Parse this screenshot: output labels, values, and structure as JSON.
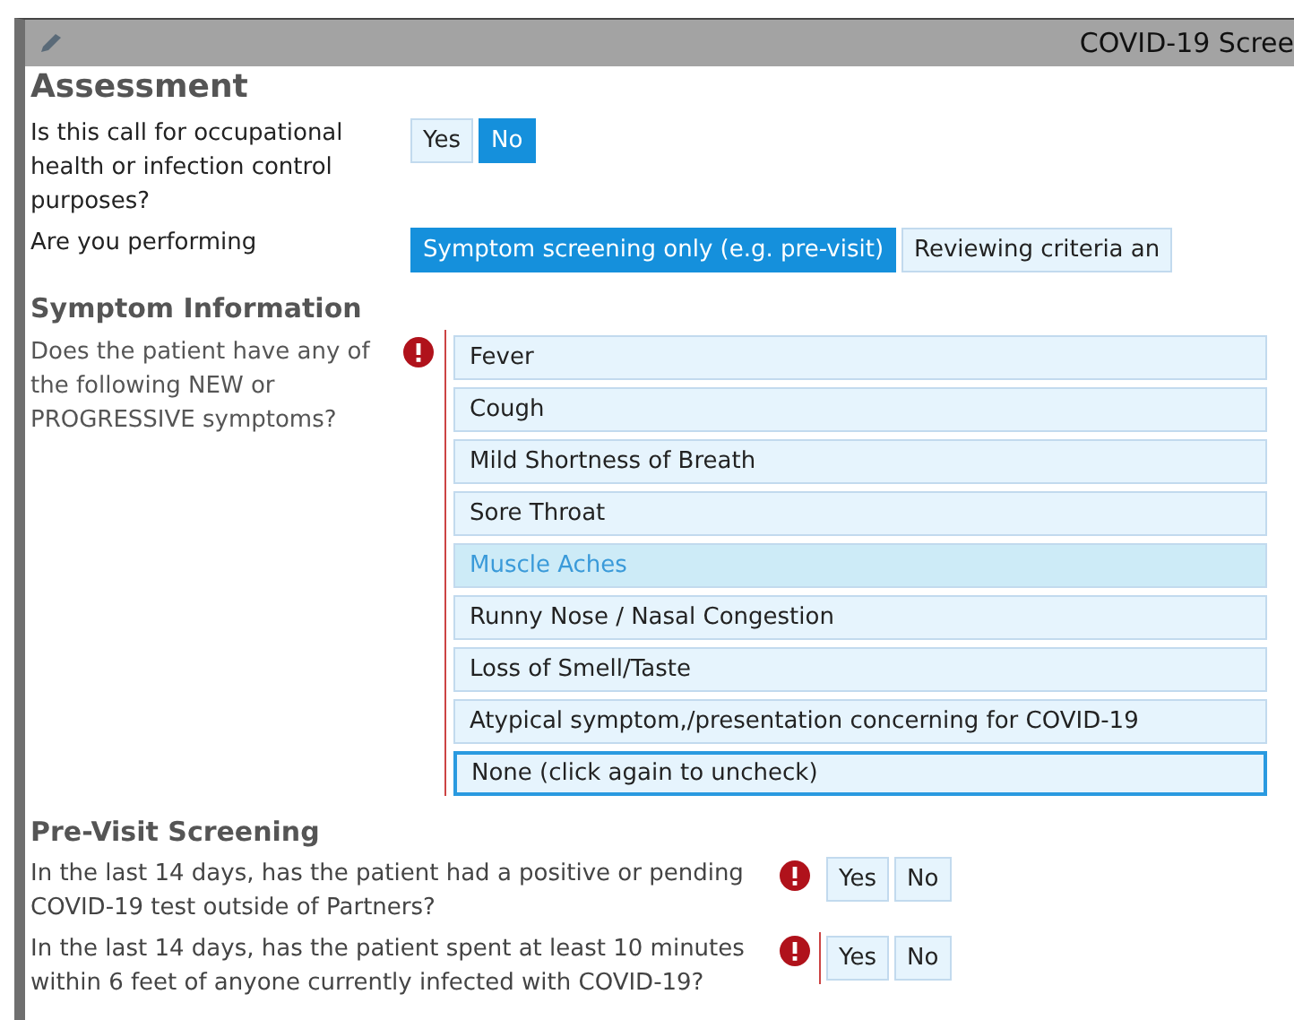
{
  "window": {
    "title": "COVID-19 Scree"
  },
  "assessment": {
    "heading": "Assessment",
    "questions": [
      {
        "label": "Is this call for occupational health or infection control purposes?",
        "options": [
          {
            "label": "Yes",
            "selected": false
          },
          {
            "label": "No",
            "selected": true
          }
        ]
      },
      {
        "label": "Are you performing",
        "options": [
          {
            "label": "Symptom screening only (e.g. pre-visit)",
            "selected": true
          },
          {
            "label": "Reviewing criteria an",
            "selected": false
          }
        ]
      }
    ]
  },
  "symptoms": {
    "heading": "Symptom Information",
    "label": "Does the patient have any of the following NEW or PROGRESSIVE symptoms?",
    "required": true,
    "bracket": true,
    "options": [
      {
        "label": "Fever",
        "highlighted": false,
        "focused": false
      },
      {
        "label": "Cough",
        "highlighted": false,
        "focused": false
      },
      {
        "label": "Mild Shortness of Breath",
        "highlighted": false,
        "focused": false
      },
      {
        "label": "Sore Throat",
        "highlighted": false,
        "focused": false
      },
      {
        "label": "Muscle Aches",
        "highlighted": true,
        "focused": false
      },
      {
        "label": "Runny Nose / Nasal Congestion",
        "highlighted": false,
        "focused": false
      },
      {
        "label": "Loss of Smell/Taste",
        "highlighted": false,
        "focused": false
      },
      {
        "label": "Atypical symptom,/presentation concerning for COVID-19",
        "highlighted": false,
        "focused": false
      },
      {
        "label": "None (click again to uncheck)",
        "highlighted": false,
        "focused": true
      }
    ]
  },
  "pre_visit": {
    "heading": "Pre-Visit Screening",
    "questions": [
      {
        "label": "In the last 14 days, has the patient had a positive or pending COVID-19 test outside of Partners?",
        "required": true,
        "bracket": false,
        "options": [
          {
            "label": "Yes",
            "selected": false
          },
          {
            "label": "No",
            "selected": false
          }
        ]
      },
      {
        "label": "In the last 14 days, has the patient spent at least 10 minutes within 6 feet of anyone currently infected with COVID-19?",
        "required": true,
        "bracket": true,
        "options": [
          {
            "label": "Yes",
            "selected": false
          },
          {
            "label": "No",
            "selected": false
          }
        ]
      }
    ]
  }
}
